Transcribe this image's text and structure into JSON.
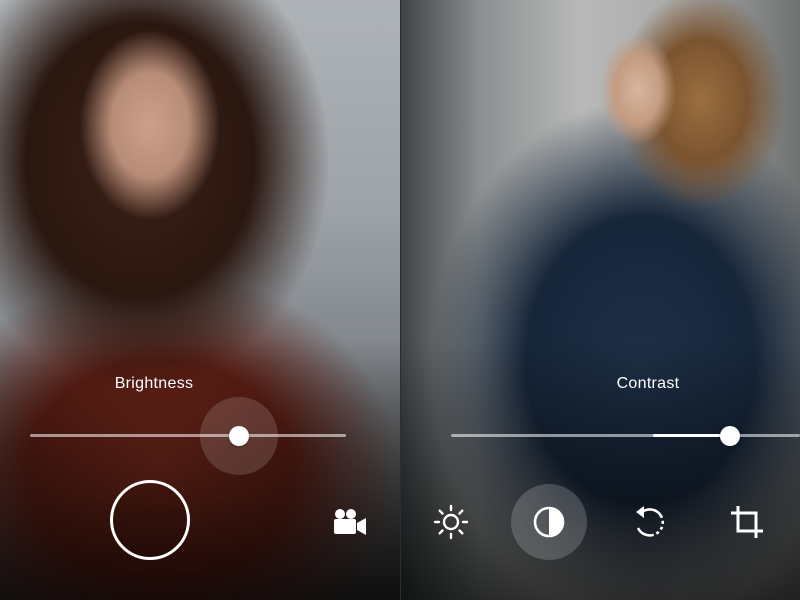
{
  "left_screen": {
    "adjustment_label": "Brightness",
    "slider_value": 0.66,
    "controls": {
      "shutter": "shutter-button",
      "video": "video-camera-icon"
    }
  },
  "right_screen": {
    "adjustment_label": "Contrast",
    "slider_value": 0.8,
    "tools": [
      {
        "name": "brightness",
        "icon": "sun-icon",
        "active": false
      },
      {
        "name": "contrast",
        "icon": "contrast-icon",
        "active": true
      },
      {
        "name": "rotate",
        "icon": "rotate-icon",
        "active": false
      },
      {
        "name": "crop",
        "icon": "crop-icon",
        "active": false
      }
    ]
  },
  "colors": {
    "ui_foreground": "#ffffff",
    "track_inactive": "rgba(255,255,255,0.55)",
    "active_tool_background": "rgba(255,255,255,0.18)"
  }
}
